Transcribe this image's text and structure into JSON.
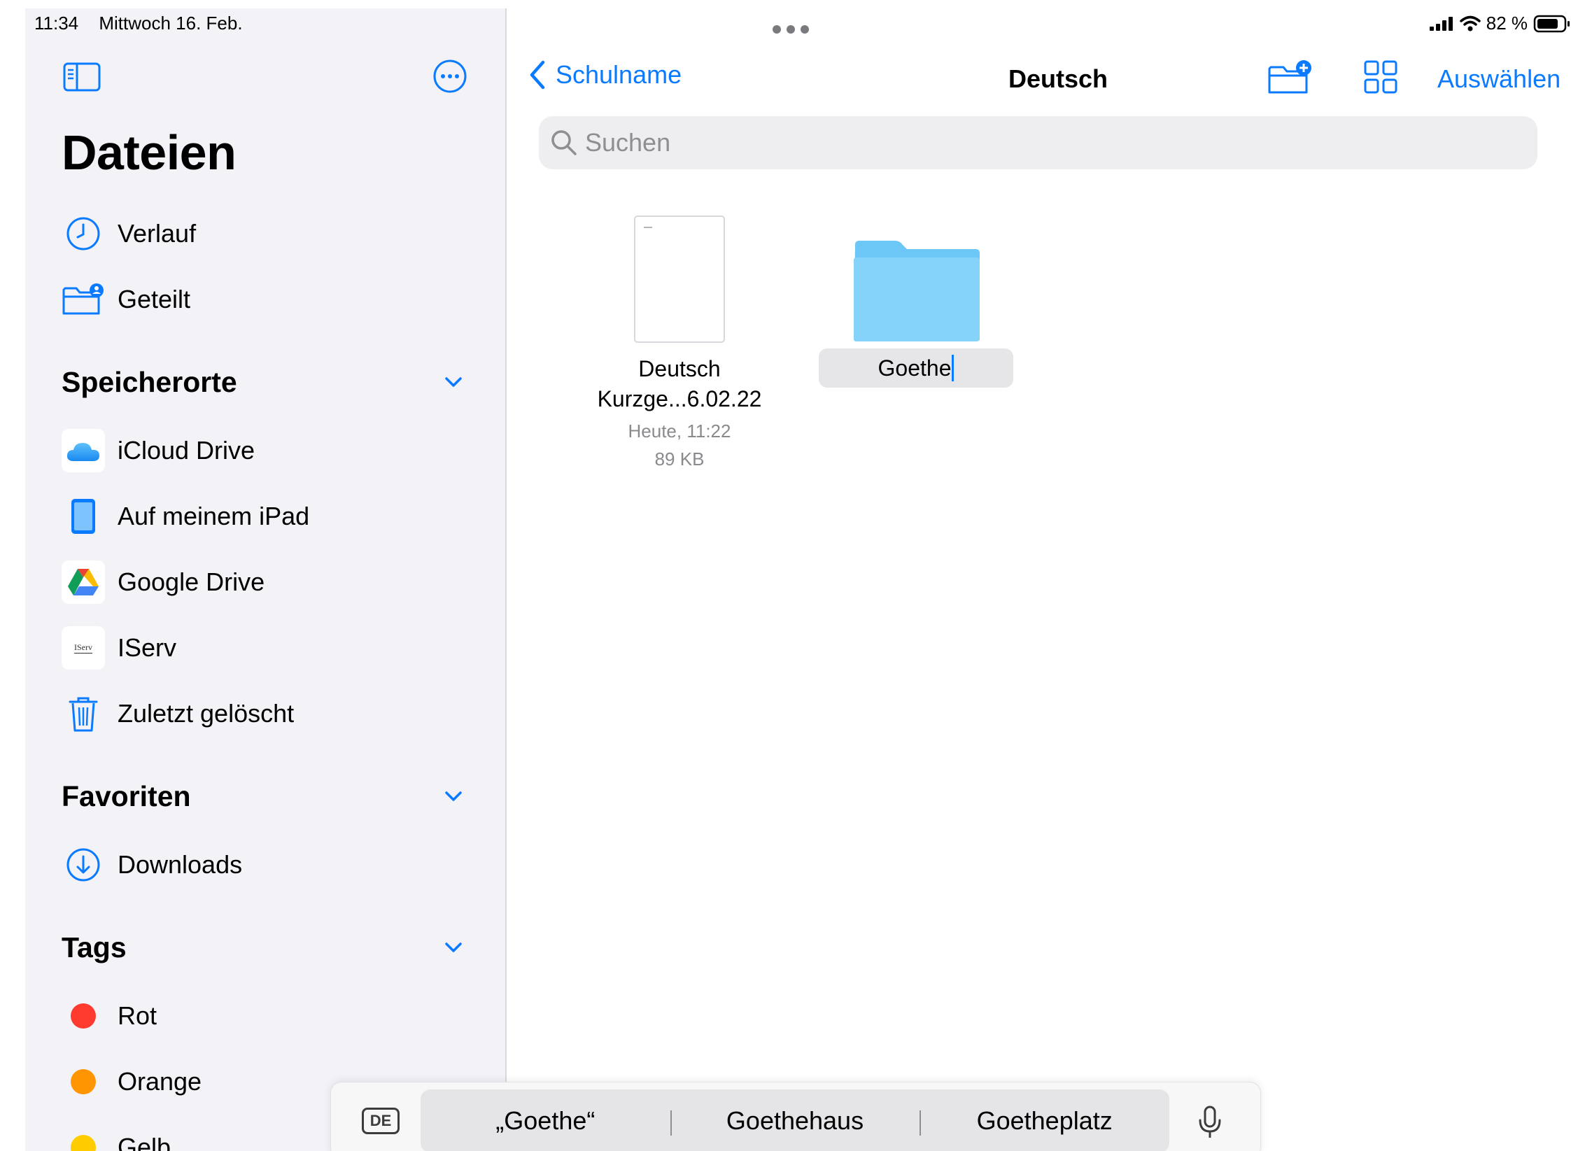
{
  "status": {
    "time": "11:34",
    "date": "Mittwoch 16. Feb.",
    "battery": "82 %"
  },
  "sidebar": {
    "title": "Dateien",
    "recent_label": "Verlauf",
    "shared_label": "Geteilt",
    "locations_header": "Speicherorte",
    "locations": [
      {
        "label": "iCloud Drive"
      },
      {
        "label": "Auf meinem iPad"
      },
      {
        "label": "Google Drive"
      },
      {
        "label": "IServ",
        "icon_text": "IServ"
      },
      {
        "label": "Zuletzt gelöscht"
      }
    ],
    "favorites_header": "Favoriten",
    "favorites": [
      {
        "label": "Downloads"
      }
    ],
    "tags_header": "Tags",
    "tags": [
      {
        "label": "Rot",
        "color": "#ff3b30"
      },
      {
        "label": "Orange",
        "color": "#ff9500"
      },
      {
        "label": "Gelb",
        "color": "#ffcc00"
      }
    ]
  },
  "nav": {
    "back_label": "Schulname",
    "title": "Deutsch",
    "select_label": "Auswählen"
  },
  "search": {
    "placeholder": "Suchen"
  },
  "files": [
    {
      "name_line1": "Deutsch",
      "name_line2": "Kurzge...6.02.22",
      "date": "Heute, 11:22",
      "size": "89 KB"
    }
  ],
  "folders": [
    {
      "name": "Goethe",
      "color": "#7fd0f7"
    }
  ],
  "keyboard": {
    "language": "DE",
    "suggestions": [
      "„Goethe“",
      "Goethehaus",
      "Goetheplatz"
    ]
  },
  "colors": {
    "accent": "#0a7aff"
  }
}
